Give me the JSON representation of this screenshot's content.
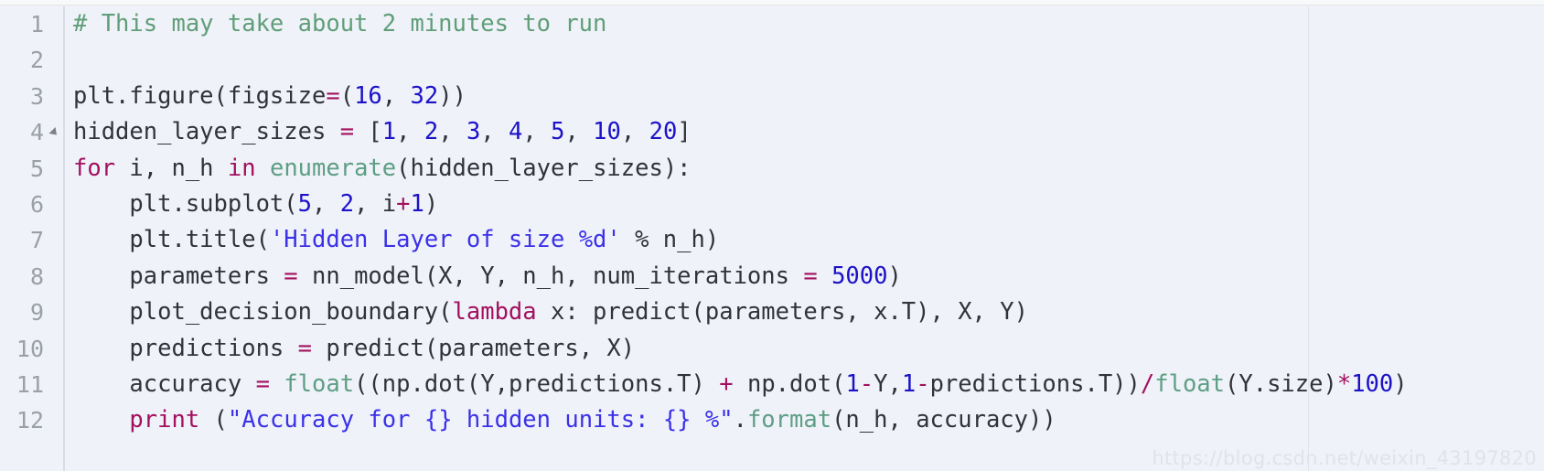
{
  "editor": {
    "background": "#eff2f8",
    "gutter_text_color": "#9b9fa6",
    "ruler_color": "#e2e3e8",
    "default_text_color": "#30343a",
    "language": "python",
    "first_line_number": 1,
    "last_line_number": 12,
    "fold_marker_line": 4
  },
  "palette": {
    "comment": "#5f9e78",
    "keyword": "#a3105f",
    "builtin": "#5e9e84",
    "string": "#3b31e8",
    "number": "#1c12c8",
    "operator": "#a3105f",
    "plain": "#30343a"
  },
  "watermark": {
    "text": "https://blog.csdn.net/weixin_43197820"
  },
  "code": {
    "lines": [
      {
        "number": "1",
        "text": "# This may take about 2 minutes to run",
        "tokens": [
          {
            "t": "# This may take about 2 minutes to run",
            "c": "comment"
          }
        ]
      },
      {
        "number": "2",
        "text": "",
        "tokens": []
      },
      {
        "number": "3",
        "text": "plt.figure(figsize=(16, 32))",
        "tokens": [
          {
            "t": "plt.figure(figsize",
            "c": "plain"
          },
          {
            "t": "=",
            "c": "operator"
          },
          {
            "t": "(",
            "c": "plain"
          },
          {
            "t": "16",
            "c": "number"
          },
          {
            "t": ", ",
            "c": "plain"
          },
          {
            "t": "32",
            "c": "number"
          },
          {
            "t": "))",
            "c": "plain"
          }
        ]
      },
      {
        "number": "4",
        "text": "hidden_layer_sizes = [1, 2, 3, 4, 5, 10, 20]",
        "tokens": [
          {
            "t": "hidden_layer_sizes ",
            "c": "plain"
          },
          {
            "t": "=",
            "c": "operator"
          },
          {
            "t": " [",
            "c": "plain"
          },
          {
            "t": "1",
            "c": "number"
          },
          {
            "t": ", ",
            "c": "plain"
          },
          {
            "t": "2",
            "c": "number"
          },
          {
            "t": ", ",
            "c": "plain"
          },
          {
            "t": "3",
            "c": "number"
          },
          {
            "t": ", ",
            "c": "plain"
          },
          {
            "t": "4",
            "c": "number"
          },
          {
            "t": ", ",
            "c": "plain"
          },
          {
            "t": "5",
            "c": "number"
          },
          {
            "t": ", ",
            "c": "plain"
          },
          {
            "t": "10",
            "c": "number"
          },
          {
            "t": ", ",
            "c": "plain"
          },
          {
            "t": "20",
            "c": "number"
          },
          {
            "t": "]",
            "c": "plain"
          }
        ]
      },
      {
        "number": "5",
        "text": "for i, n_h in enumerate(hidden_layer_sizes):",
        "tokens": [
          {
            "t": "for",
            "c": "keyword"
          },
          {
            "t": " i, n_h ",
            "c": "plain"
          },
          {
            "t": "in",
            "c": "keyword"
          },
          {
            "t": " ",
            "c": "plain"
          },
          {
            "t": "enumerate",
            "c": "builtin"
          },
          {
            "t": "(hidden_layer_sizes):",
            "c": "plain"
          }
        ]
      },
      {
        "number": "6",
        "text": "    plt.subplot(5, 2, i+1)",
        "tokens": [
          {
            "t": "    plt.subplot(",
            "c": "plain"
          },
          {
            "t": "5",
            "c": "number"
          },
          {
            "t": ", ",
            "c": "plain"
          },
          {
            "t": "2",
            "c": "number"
          },
          {
            "t": ", i",
            "c": "plain"
          },
          {
            "t": "+",
            "c": "operator"
          },
          {
            "t": "1",
            "c": "number"
          },
          {
            "t": ")",
            "c": "plain"
          }
        ]
      },
      {
        "number": "7",
        "text": "    plt.title('Hidden Layer of size %d' % n_h)",
        "tokens": [
          {
            "t": "    plt.title(",
            "c": "plain"
          },
          {
            "t": "'Hidden Layer of size %d'",
            "c": "string"
          },
          {
            "t": " % n_h)",
            "c": "plain"
          }
        ]
      },
      {
        "number": "8",
        "text": "    parameters = nn_model(X, Y, n_h, num_iterations = 5000)",
        "tokens": [
          {
            "t": "    parameters ",
            "c": "plain"
          },
          {
            "t": "=",
            "c": "operator"
          },
          {
            "t": " nn_model(X, Y, n_h, num_iterations ",
            "c": "plain"
          },
          {
            "t": "=",
            "c": "operator"
          },
          {
            "t": " ",
            "c": "plain"
          },
          {
            "t": "5000",
            "c": "number"
          },
          {
            "t": ")",
            "c": "plain"
          }
        ]
      },
      {
        "number": "9",
        "text": "    plot_decision_boundary(lambda x: predict(parameters, x.T), X, Y)",
        "tokens": [
          {
            "t": "    plot_decision_boundary(",
            "c": "plain"
          },
          {
            "t": "lambda",
            "c": "keyword"
          },
          {
            "t": " x: predict(parameters, x.T), X, Y)",
            "c": "plain"
          }
        ]
      },
      {
        "number": "10",
        "text": "    predictions = predict(parameters, X)",
        "tokens": [
          {
            "t": "    predictions ",
            "c": "plain"
          },
          {
            "t": "=",
            "c": "operator"
          },
          {
            "t": " predict(parameters, X)",
            "c": "plain"
          }
        ]
      },
      {
        "number": "11",
        "text": "    accuracy = float((np.dot(Y,predictions.T) + np.dot(1-Y,1-predictions.T))/float(Y.size)*100)",
        "tokens": [
          {
            "t": "    accuracy ",
            "c": "plain"
          },
          {
            "t": "=",
            "c": "operator"
          },
          {
            "t": " ",
            "c": "plain"
          },
          {
            "t": "float",
            "c": "builtin"
          },
          {
            "t": "((np.dot(Y,predictions.T) ",
            "c": "plain"
          },
          {
            "t": "+",
            "c": "operator"
          },
          {
            "t": " np.dot(",
            "c": "plain"
          },
          {
            "t": "1",
            "c": "number"
          },
          {
            "t": "-",
            "c": "operator"
          },
          {
            "t": "Y,",
            "c": "plain"
          },
          {
            "t": "1",
            "c": "number"
          },
          {
            "t": "-",
            "c": "operator"
          },
          {
            "t": "predictions.T))",
            "c": "plain"
          },
          {
            "t": "/",
            "c": "operator"
          },
          {
            "t": "float",
            "c": "builtin"
          },
          {
            "t": "(Y.size)",
            "c": "plain"
          },
          {
            "t": "*",
            "c": "operator"
          },
          {
            "t": "100",
            "c": "number"
          },
          {
            "t": ")",
            "c": "plain"
          }
        ]
      },
      {
        "number": "12",
        "text": "    print (\"Accuracy for {} hidden units: {} %\".format(n_h, accuracy))",
        "tokens": [
          {
            "t": "    ",
            "c": "plain"
          },
          {
            "t": "print",
            "c": "keyword"
          },
          {
            "t": " (",
            "c": "plain"
          },
          {
            "t": "\"Accuracy for {} hidden units: {} %\"",
            "c": "string"
          },
          {
            "t": ".",
            "c": "plain"
          },
          {
            "t": "format",
            "c": "builtin"
          },
          {
            "t": "(n_h, accuracy))",
            "c": "plain"
          }
        ]
      }
    ]
  }
}
